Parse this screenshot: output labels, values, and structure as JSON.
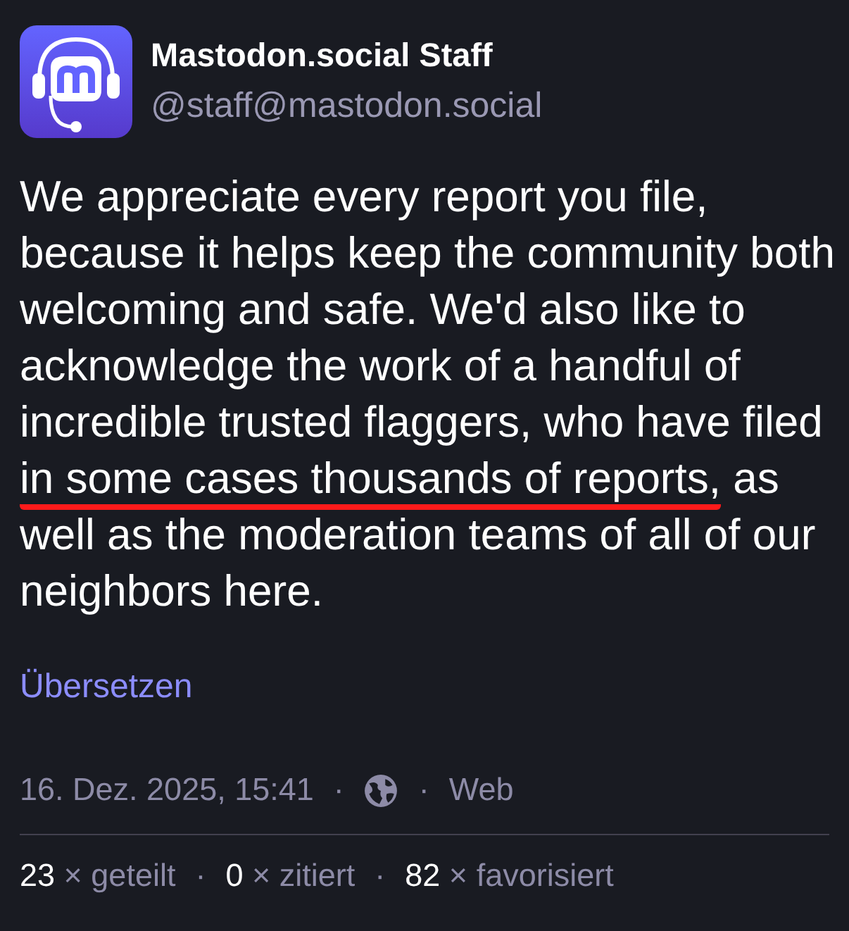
{
  "author": {
    "name": "Mastodon.social Staff",
    "handle": "@staff@mastodon.social"
  },
  "body": [
    {
      "text": "We appreciate every report you file, because it helps keep the community both welcoming and safe. We'd also like to acknowledge the work of a handful of incredible trusted flaggers, who have filed ",
      "marked": false
    },
    {
      "text": "in some cases thousands of reports,",
      "marked": true
    },
    {
      "text": " as well as the moderation teams of all of our neighbors here.",
      "marked": false
    }
  ],
  "translate_link": "Übersetzen",
  "separator": "·",
  "meta": {
    "date": "16. Dez. 2025, 15:41",
    "source": "Web"
  },
  "stats": [
    {
      "count": "23",
      "label": "× geteilt"
    },
    {
      "count": "0",
      "label": "× zitiert"
    },
    {
      "count": "82",
      "label": "× favorisiert"
    }
  ]
}
